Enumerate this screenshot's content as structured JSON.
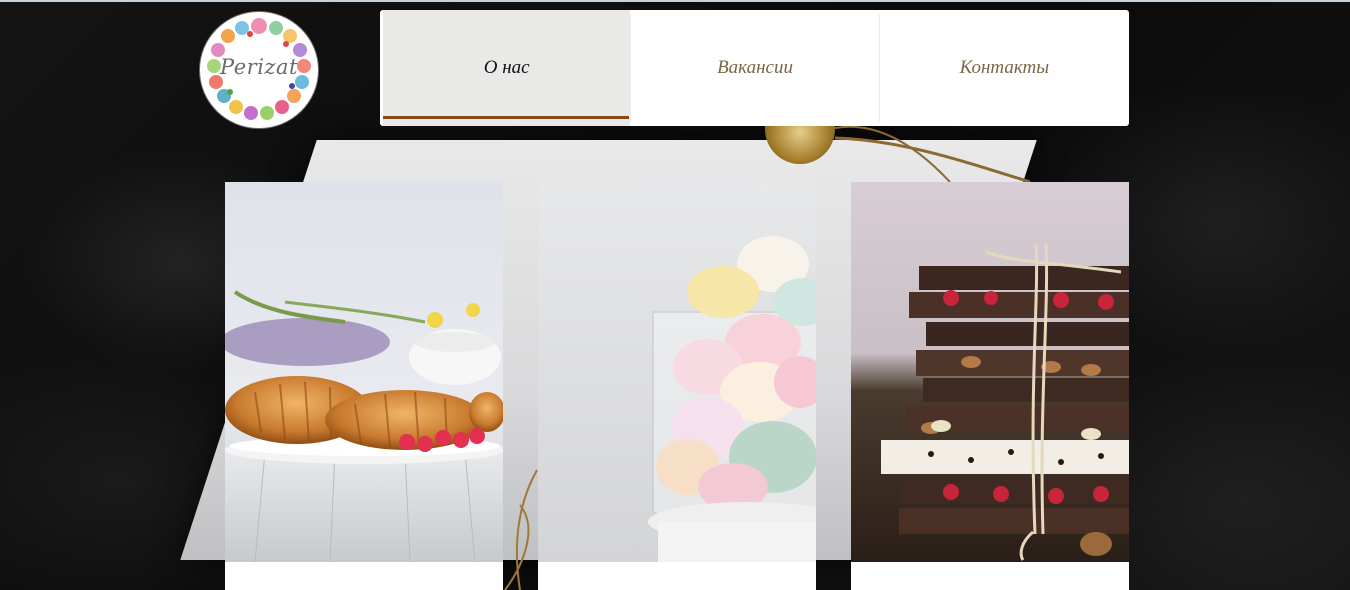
{
  "logo": {
    "text": "Perizat"
  },
  "nav": {
    "tabs": [
      {
        "label": "О нас",
        "active": true
      },
      {
        "label": "Вакансии",
        "active": false
      },
      {
        "label": "Контакты",
        "active": false
      }
    ],
    "active_underline_color": "#8b4a14"
  },
  "cards": [
    {
      "image": "croissants-with-raspberries"
    },
    {
      "image": "marshmallows-in-glass"
    },
    {
      "image": "chocolate-bar-stack"
    }
  ]
}
